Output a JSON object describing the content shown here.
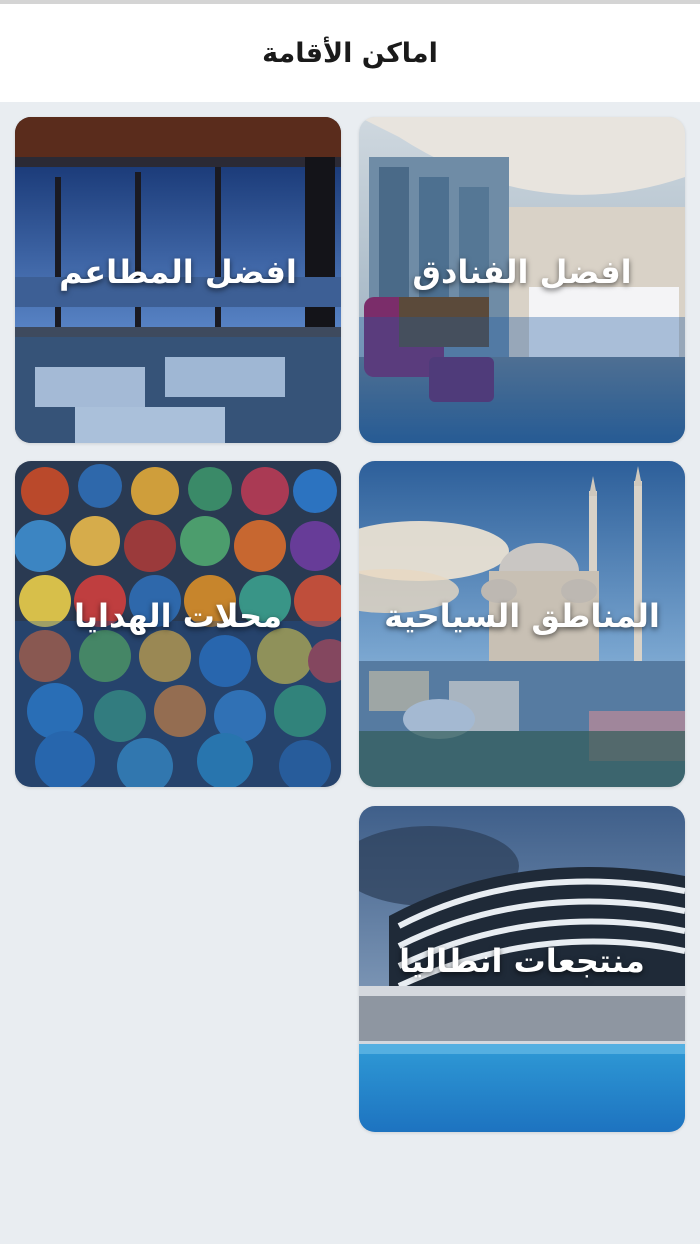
{
  "header": {
    "title": "اماكن الأقامة"
  },
  "cards": {
    "hotels": {
      "label": "افضل الفنادق"
    },
    "restaurants": {
      "label": "افضل المطاعم"
    },
    "tourist_areas": {
      "label": "المناطق السياحية"
    },
    "gift_shops": {
      "label": "محلات الهدايا"
    },
    "antalya_resorts": {
      "label": "منتجعات انطاليا"
    }
  }
}
